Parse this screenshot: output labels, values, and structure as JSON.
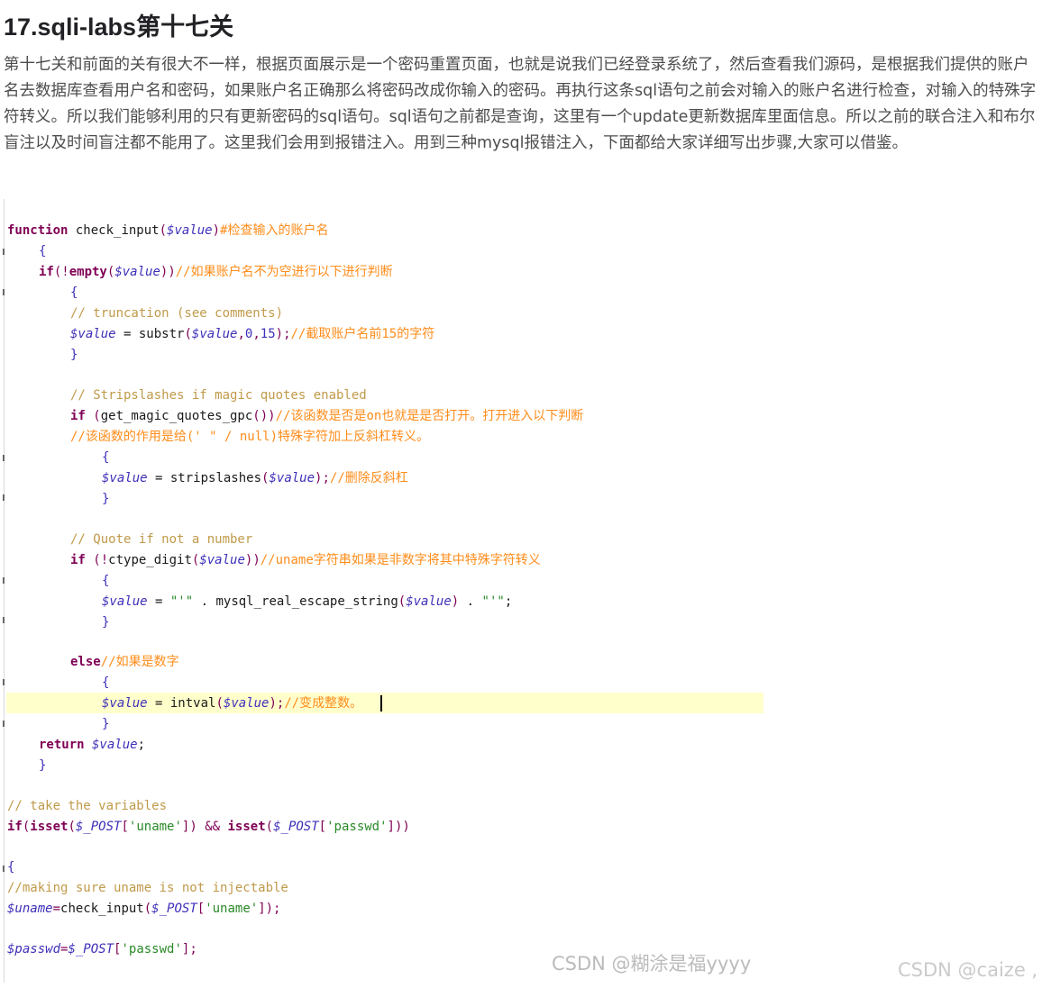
{
  "article": {
    "title": "17.sqli-labs第十七关",
    "paragraph": "第十七关和前面的关有很大不一样，根据页面展示是一个密码重置页面，也就是说我们已经登录系统了，然后查看我们源码，是根据我们提供的账户名去数据库查看用户名和密码，如果账户名正确那么将密码改成你输入的密码。再执行这条sql语句之前会对输入的账户名进行检查，对输入的特殊字符转义。所以我们能够利用的只有更新密码的sql语句。sql语句之前都是查询，这里有一个update更新数据库里面信息。所以之前的联合注入和布尔盲注以及时间盲注都不能用了。这里我们会用到报错注入。用到三种mysql报错注入，下面都给大家详细写出步骤,大家可以借鉴。"
  },
  "code": {
    "l1_kw": "function",
    "l1_fn": " check_input",
    "l1_p1": "(",
    "l1_var": "$value",
    "l1_p2": ")",
    "l1_cm": "#检查输入的账户名",
    "l2": "{",
    "l3_kw": "if",
    "l3_op": "(!",
    "l3_fn": "empty",
    "l3_p1": "(",
    "l3_var": "$value",
    "l3_p2": "))",
    "l3_cm": "//如果账户名不为空进行以下进行判断",
    "l4": "{",
    "l5": "// truncation (see comments)",
    "l6_var": "$value",
    "l6_eq": " = ",
    "l6_fn": "substr",
    "l6_p1": "(",
    "l6_var2": "$value",
    "l6_c1": ",",
    "l6_n1": "0",
    "l6_c2": ",",
    "l6_n2": "15",
    "l6_p2": ");",
    "l6_cm": "//截取账户名前15的字符",
    "l7": "}",
    "l8": "// Stripslashes if magic quotes enabled",
    "l9_kw": "if",
    "l9_p1": " (",
    "l9_fn": "get_magic_quotes_gpc",
    "l9_p2": "())",
    "l9_cm": "//该函数是否是on也就是是否打开。打开进入以下判断",
    "l10": "//该函数的作用是给(' \" / null)特殊字符加上反斜杠转义。",
    "l11": "{",
    "l12_var": "$value",
    "l12_eq": " = ",
    "l12_fn": "stripslashes",
    "l12_p1": "(",
    "l12_var2": "$value",
    "l12_p2": ");",
    "l12_cm": "//删除反斜杠",
    "l13": "}",
    "l14": "// Quote if not a number",
    "l15_kw": "if",
    "l15_p1": " (!",
    "l15_fn": "ctype_digit",
    "l15_p2": "(",
    "l15_var": "$value",
    "l15_p3": "))",
    "l15_cm": "//uname字符串如果是非数字将其中特殊字符转义",
    "l16": "{",
    "l17_var": "$value",
    "l17_eq": " = ",
    "l17_s1": "\"'\"",
    "l17_dot1": " . ",
    "l17_fn": "mysql_real_escape_string",
    "l17_p1": "(",
    "l17_var2": "$value",
    "l17_p2": ")",
    "l17_dot2": " . ",
    "l17_s2": "\"'\"",
    "l17_end": ";",
    "l18": "}",
    "l19_kw": "else",
    "l19_cm": "//如果是数字",
    "l20": "{",
    "l21_var": "$value",
    "l21_eq": " = ",
    "l21_fn": "intval",
    "l21_p1": "(",
    "l21_var2": "$value",
    "l21_p2": ");",
    "l21_cm": "//变成整数。",
    "l22": "}",
    "l23_kw": "return",
    "l23_var": " $value",
    "l23_end": ";",
    "l24": "}",
    "l25": "// take the variables",
    "l26_kw": "if",
    "l26_p1": "(",
    "l26_fn": "isset",
    "l26_p2": "(",
    "l26_v1": "$_POST",
    "l26_b1": "[",
    "l26_s1": "'uname'",
    "l26_b2": "])",
    "l26_and": " && ",
    "l26_fn2": "isset",
    "l26_p3": "(",
    "l26_v2": "$_POST",
    "l26_b3": "[",
    "l26_s2": "'passwd'",
    "l26_b4": "]))",
    "l27": "{",
    "l28": "//making sure uname is not injectable",
    "l29_var": "$uname",
    "l29_eq": "=",
    "l29_fn": "check_input",
    "l29_p1": "(",
    "l29_v2": "$_POST",
    "l29_b1": "[",
    "l29_s": "'uname'",
    "l29_b2": "]);",
    "l30_var": "$passwd",
    "l30_eq": "=",
    "l30_v2": "$_POST",
    "l30_b1": "[",
    "l30_s": "'passwd'",
    "l30_b2": "];"
  },
  "watermarks": {
    "inner": "CSDN @糊涂是福yyyy",
    "outer": "CSDN @caize ,"
  }
}
